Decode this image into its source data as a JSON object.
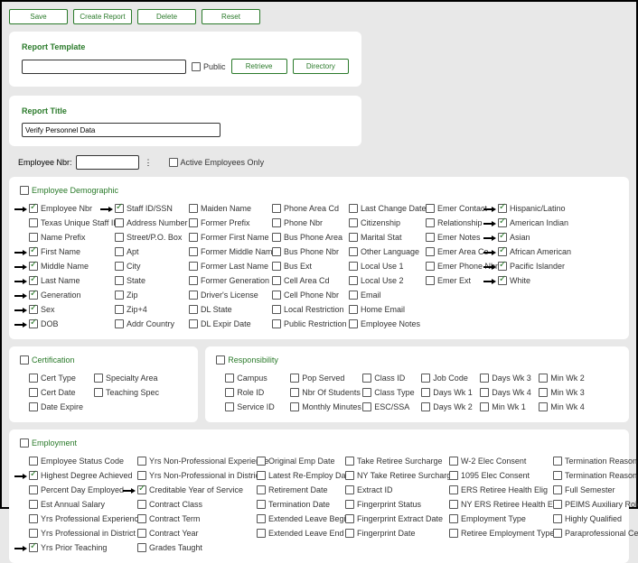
{
  "buttons": {
    "save": "Save",
    "create_report": "Create Report",
    "delete": "Delete",
    "reset": "Reset",
    "retrieve": "Retrieve",
    "directory": "Directory"
  },
  "report_template": {
    "title": "Report Template",
    "public_label": "Public"
  },
  "report_title": {
    "title": "Report Title",
    "value": "Verify Personnel Data"
  },
  "emp_row": {
    "label": "Employee Nbr:",
    "active_only": "Active Employees Only"
  },
  "demo": {
    "title": "Employee Demographic",
    "c1": [
      {
        "l": "Employee Nbr",
        "ck": true,
        "ar": true
      },
      {
        "l": "Texas Unique Staff ID",
        "ck": false,
        "ar": false
      },
      {
        "l": "Name Prefix",
        "ck": false,
        "ar": false
      },
      {
        "l": "First Name",
        "ck": true,
        "ar": true
      },
      {
        "l": "Middle Name",
        "ck": true,
        "ar": true
      },
      {
        "l": "Last Name",
        "ck": true,
        "ar": true
      },
      {
        "l": "Generation",
        "ck": true,
        "ar": true
      },
      {
        "l": "Sex",
        "ck": true,
        "ar": true
      },
      {
        "l": "DOB",
        "ck": true,
        "ar": true
      }
    ],
    "c2": [
      {
        "l": "Staff ID/SSN",
        "ck": true,
        "ar": true
      },
      {
        "l": "Address Number",
        "ck": false,
        "ar": false
      },
      {
        "l": "Street/P.O. Box",
        "ck": false,
        "ar": false
      },
      {
        "l": "Apt",
        "ck": false,
        "ar": false
      },
      {
        "l": "City",
        "ck": false,
        "ar": false
      },
      {
        "l": "State",
        "ck": false,
        "ar": false
      },
      {
        "l": "Zip",
        "ck": false,
        "ar": false
      },
      {
        "l": "Zip+4",
        "ck": false,
        "ar": false
      },
      {
        "l": "Addr Country",
        "ck": false,
        "ar": false
      }
    ],
    "c3": [
      {
        "l": "Maiden Name"
      },
      {
        "l": "Former Prefix"
      },
      {
        "l": "Former First Name"
      },
      {
        "l": "Former Middle Name"
      },
      {
        "l": "Former Last Name"
      },
      {
        "l": "Former Generation"
      },
      {
        "l": "Driver's License"
      },
      {
        "l": "DL State"
      },
      {
        "l": "DL Expir Date"
      }
    ],
    "c4": [
      {
        "l": "Phone Area Cd"
      },
      {
        "l": "Phone Nbr"
      },
      {
        "l": "Bus Phone Area"
      },
      {
        "l": "Bus Phone Nbr"
      },
      {
        "l": "Bus Ext"
      },
      {
        "l": "Cell Area Cd"
      },
      {
        "l": "Cell Phone Nbr"
      },
      {
        "l": "Local Restriction"
      },
      {
        "l": "Public Restriction"
      }
    ],
    "c5": [
      {
        "l": "Last Change Date"
      },
      {
        "l": "Citizenship"
      },
      {
        "l": "Marital Stat"
      },
      {
        "l": "Other Language"
      },
      {
        "l": "Local Use 1"
      },
      {
        "l": "Local Use 2"
      },
      {
        "l": "Email"
      },
      {
        "l": "Home Email"
      },
      {
        "l": "Employee Notes"
      }
    ],
    "c6": [
      {
        "l": "Emer Contact"
      },
      {
        "l": "Relationship"
      },
      {
        "l": "Emer Notes"
      },
      {
        "l": "Emer Area Co"
      },
      {
        "l": "Emer Phone Nbr"
      },
      {
        "l": "Emer Ext"
      }
    ],
    "c7": [
      {
        "l": "Hispanic/Latino",
        "ck": true,
        "ar": true
      },
      {
        "l": "American Indian",
        "ck": true,
        "ar": true
      },
      {
        "l": "Asian",
        "ck": true,
        "ar": true
      },
      {
        "l": "African American",
        "ck": true,
        "ar": true
      },
      {
        "l": "Pacific Islander",
        "ck": true,
        "ar": true
      },
      {
        "l": "White",
        "ck": true,
        "ar": true
      }
    ]
  },
  "cert": {
    "title": "Certification",
    "c1": [
      {
        "l": "Cert Type"
      },
      {
        "l": "Cert Date"
      },
      {
        "l": "Date Expire"
      }
    ],
    "c2": [
      {
        "l": "Specialty Area"
      },
      {
        "l": "Teaching Spec"
      }
    ]
  },
  "resp": {
    "title": "Responsibility",
    "c1": [
      {
        "l": "Campus"
      },
      {
        "l": "Role ID"
      },
      {
        "l": "Service ID"
      }
    ],
    "c2": [
      {
        "l": "Pop Served"
      },
      {
        "l": "Nbr Of Students"
      },
      {
        "l": "Monthly Minutes"
      }
    ],
    "c3": [
      {
        "l": "Class ID"
      },
      {
        "l": "Class Type"
      },
      {
        "l": "ESC/SSA"
      }
    ],
    "c4": [
      {
        "l": "Job Code"
      },
      {
        "l": "Days Wk 1"
      },
      {
        "l": "Days Wk 2"
      }
    ],
    "c5": [
      {
        "l": "Days Wk 3"
      },
      {
        "l": "Days Wk 4"
      },
      {
        "l": "Min Wk 1"
      }
    ],
    "c6": [
      {
        "l": "Min Wk 2"
      },
      {
        "l": "Min Wk 3"
      },
      {
        "l": "Min Wk 4"
      }
    ]
  },
  "emp": {
    "title": "Employment",
    "c1": [
      {
        "l": "Employee Status Code",
        "ck": false,
        "ar": false
      },
      {
        "l": "Highest Degree Achieved",
        "ck": true,
        "ar": true
      },
      {
        "l": "Percent Day Employed",
        "ck": false,
        "ar": false
      },
      {
        "l": "Est Annual Salary",
        "ck": false,
        "ar": false
      },
      {
        "l": "Yrs Professional Experience",
        "ck": false,
        "ar": false
      },
      {
        "l": "Yrs Professional in District",
        "ck": false,
        "ar": false
      },
      {
        "l": "Yrs Prior Teaching",
        "ck": true,
        "ar": true
      }
    ],
    "c2": [
      {
        "l": "Yrs Non-Professional Experience",
        "ck": false,
        "ar": false
      },
      {
        "l": "Yrs Non-Professional in District",
        "ck": false,
        "ar": false
      },
      {
        "l": "Creditable Year of Service",
        "ck": true,
        "ar": true
      },
      {
        "l": "Contract Class",
        "ck": false,
        "ar": false
      },
      {
        "l": "Contract Term",
        "ck": false,
        "ar": false
      },
      {
        "l": "Contract Year",
        "ck": false,
        "ar": false
      },
      {
        "l": "Grades Taught",
        "ck": false,
        "ar": false
      }
    ],
    "c3": [
      {
        "l": "Original Emp Date"
      },
      {
        "l": "Latest Re-Employ Date"
      },
      {
        "l": "Retirement Date"
      },
      {
        "l": "Termination Date"
      },
      {
        "l": "Extended Leave Begin"
      },
      {
        "l": "Extended Leave End"
      }
    ],
    "c4": [
      {
        "l": "Take Retiree Surcharge"
      },
      {
        "l": "NY Take Retiree Surcharge"
      },
      {
        "l": "Extract ID"
      },
      {
        "l": "Fingerprint Status"
      },
      {
        "l": "Fingerprint Extract Date"
      },
      {
        "l": "Fingerprint Date"
      }
    ],
    "c5": [
      {
        "l": "W-2 Elec Consent"
      },
      {
        "l": "1095 Elec Consent"
      },
      {
        "l": "ERS Retiree Health Elig"
      },
      {
        "l": "NY ERS Retiree Health Elig"
      },
      {
        "l": "Employment Type"
      },
      {
        "l": "Retiree Employment Type"
      }
    ],
    "c6": [
      {
        "l": "Termination Reason"
      },
      {
        "l": "Termination Reason Descr"
      },
      {
        "l": "Full Semester"
      },
      {
        "l": "PEIMS Auxiliary Role ID"
      },
      {
        "l": "Highly Qualified"
      },
      {
        "l": "Paraprofessional Certification"
      }
    ]
  }
}
